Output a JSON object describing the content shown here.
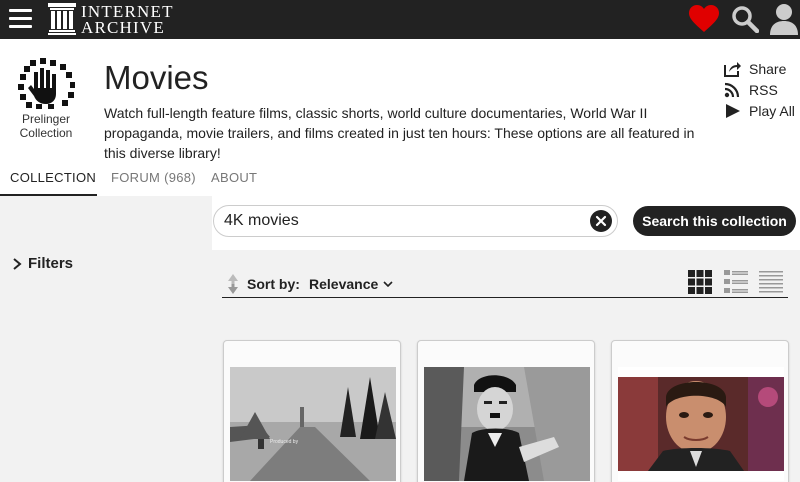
{
  "topbar": {
    "logo_line1": "INTERNET",
    "logo_line2": "ARCHIVE",
    "heart_color": "#e00000"
  },
  "header": {
    "logo_text_line1": "Prelinger",
    "logo_text_line2": "Collection",
    "title": "Movies",
    "description": "Watch full-length feature films, classic shorts, world culture documentaries, World War II propaganda, movie trailers, and films created in just ten hours: These options are all featured in this diverse library!",
    "actions": [
      {
        "label": "Share",
        "icon": "share-icon"
      },
      {
        "label": "RSS",
        "icon": "rss-icon"
      },
      {
        "label": "Play All",
        "icon": "play-icon"
      }
    ]
  },
  "tabs": [
    {
      "label": "COLLECTION",
      "active": true
    },
    {
      "label": "FORUM (968)",
      "active": false
    },
    {
      "label": "ABOUT",
      "active": false
    }
  ],
  "sidebar": {
    "filters_label": "Filters"
  },
  "search": {
    "value": "4K movies",
    "button_label": "Search this collection"
  },
  "sort": {
    "label": "Sort by:",
    "value": "Relevance"
  },
  "views": [
    "grid-view-icon",
    "list-view-icon",
    "compact-view-icon"
  ],
  "results": [
    {
      "thumb": "black-and-white snowy road scene",
      "caption": "Produced by"
    },
    {
      "thumb": "black-and-white silent film actor",
      "caption": ""
    },
    {
      "thumb": "color close-up of a man",
      "caption": ""
    }
  ]
}
